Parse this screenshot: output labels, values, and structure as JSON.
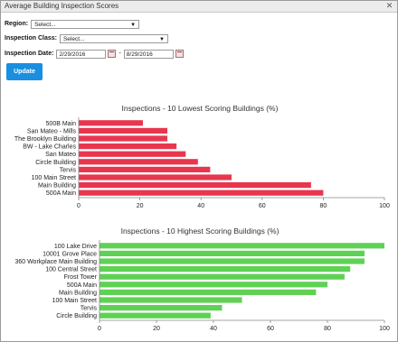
{
  "window": {
    "title": "Average Building Inspection Scores"
  },
  "filters": {
    "region_label": "Region:",
    "region_value": "Select...",
    "class_label": "Inspection Class:",
    "class_value": "Select...",
    "date_label": "Inspection Date:",
    "date_from": "2/29/2016",
    "date_sep": "-",
    "date_to": "8/29/2016"
  },
  "update_label": "Update",
  "colors": {
    "low_bar": "#e8364f",
    "high_bar": "#5fd155",
    "accent": "#1a8fe0"
  },
  "chart_data": [
    {
      "type": "bar",
      "orientation": "horizontal",
      "title": "Inspections - 10 Lowest Scoring Buildings (%)",
      "categories": [
        "500B Main",
        "San Mateo - Mills",
        "The Brooklyn Building",
        "BW - Lake Charles",
        "San Mateo",
        "Circle Building",
        "Tervis",
        "100 Main Street",
        "Main Building",
        "500A Main"
      ],
      "values": [
        21,
        29,
        29,
        32,
        35,
        39,
        43,
        50,
        76,
        80
      ],
      "xlim": [
        0,
        100
      ],
      "xticks": [
        0,
        20,
        40,
        60,
        80,
        100
      ]
    },
    {
      "type": "bar",
      "orientation": "horizontal",
      "title": "Inspections - 10 Highest Scoring Buildings (%)",
      "categories": [
        "100 Lake Drive",
        "10001 Grove Place",
        "360 Workplace Main Building",
        "100 Central Street",
        "Frost Tower",
        "500A Main",
        "Main Building",
        "100 Main Street",
        "Tervis",
        "Circle Building"
      ],
      "values": [
        100,
        93,
        93,
        88,
        86,
        80,
        76,
        50,
        43,
        39
      ],
      "xlim": [
        0,
        100
      ],
      "xticks": [
        0,
        20,
        40,
        60,
        80,
        100
      ]
    }
  ]
}
